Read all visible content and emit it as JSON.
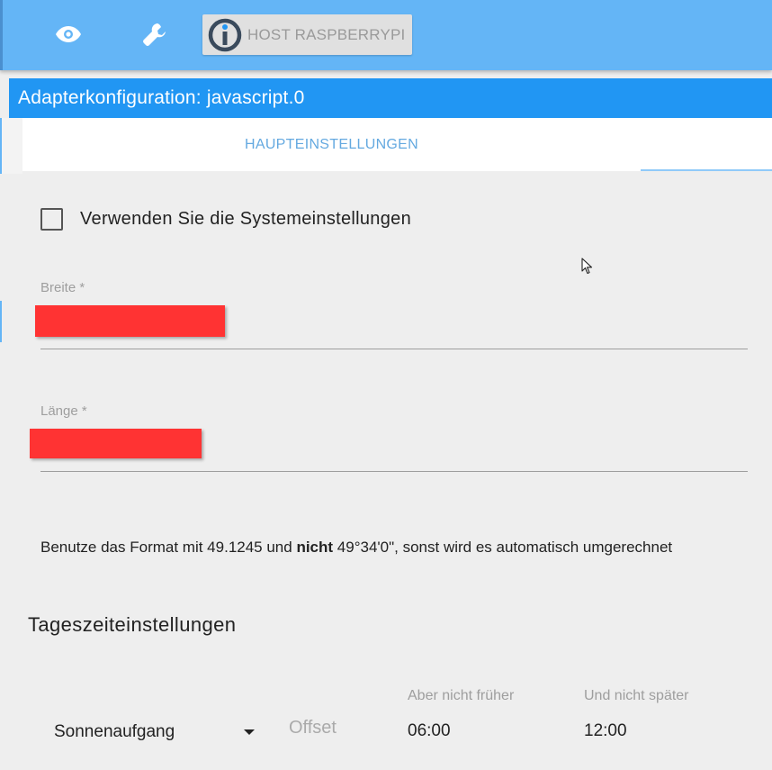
{
  "topbar": {
    "icons": [
      "eye-icon",
      "wrench-icon"
    ],
    "host_label": "HOST RASPBERRYPI",
    "color": "#64b5f6"
  },
  "dialog": {
    "title": "Adapterkonfiguration: javascript.0",
    "header_color": "#2196f3"
  },
  "tabs": {
    "main": "HAUPTEINSTELLUNGEN"
  },
  "form": {
    "use_system_label": "Verwenden Sie die Systemeinstellungen",
    "use_system_checked": false,
    "latitude_label": "Breite *",
    "longitude_label": "Länge *",
    "redaction_color": "#ff3333",
    "hint_before": "Benutze das Format mit 49.1245 und ",
    "hint_bold": "nicht",
    "hint_after": " 49°34'0\", sonst wird es automatisch umgerechnet"
  },
  "daytime": {
    "title": "Tageszeiteinstellungen",
    "event_value": "Sonnenaufgang",
    "offset_placeholder": "Offset",
    "not_earlier_label": "Aber nicht früher",
    "not_later_label": "Und nicht später",
    "not_earlier_value": "06:00",
    "not_later_value": "12:00"
  }
}
